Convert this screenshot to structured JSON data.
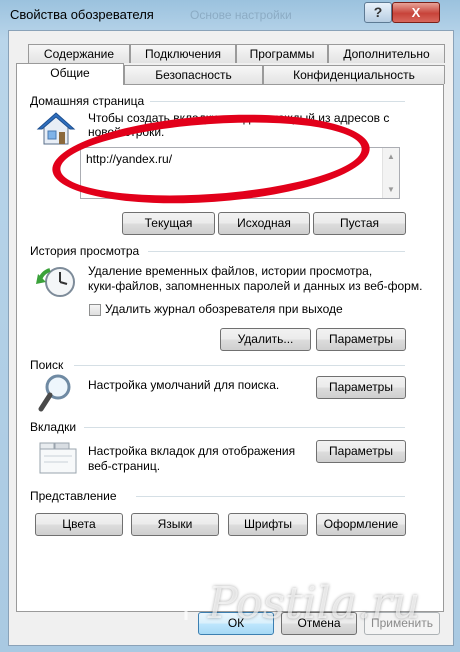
{
  "window": {
    "title": "Свойства обозревателя",
    "ghost_title": "Основе настройки",
    "help_label": "?",
    "close_label": "X"
  },
  "tabs_row1": [
    "Содержание",
    "Подключения",
    "Программы",
    "Дополнительно"
  ],
  "tabs_row2": [
    "Общие",
    "Безопасность",
    "Конфиденциальность"
  ],
  "home": {
    "label": "Домашняя страница",
    "desc1": "Чтобы создать вкладки, введите каждый из адресов с",
    "desc2": "новой строки.",
    "url": "http://yandex.ru/",
    "btn_current": "Текущая",
    "btn_default": "Исходная",
    "btn_blank": "Пустая"
  },
  "history": {
    "label": "История просмотра",
    "desc1": "Удаление временных файлов, истории просмотра,",
    "desc2": "куки-файлов, запомненных паролей и данных из веб-форм.",
    "checkbox_label": "Удалить журнал обозревателя при выходе",
    "btn_delete": "Удалить...",
    "btn_settings": "Параметры"
  },
  "search": {
    "label": "Поиск",
    "desc": "Настройка умолчаний для поиска.",
    "btn_settings": "Параметры"
  },
  "tabs_group": {
    "label": "Вкладки",
    "desc1": "Настройка вкладок для отображения",
    "desc2": "веб-страниц.",
    "btn_settings": "Параметры"
  },
  "appearance": {
    "label": "Представление",
    "btn_colors": "Цвета",
    "btn_languages": "Языки",
    "btn_fonts": "Шрифты",
    "btn_accessibility": "Оформление"
  },
  "footer": {
    "ok": "ОК",
    "cancel": "Отмена",
    "apply": "Применить"
  },
  "watermark": "Postila.ru",
  "colors": {
    "highlight_ellipse": "#e2001a",
    "close_button": "#c7433a"
  }
}
